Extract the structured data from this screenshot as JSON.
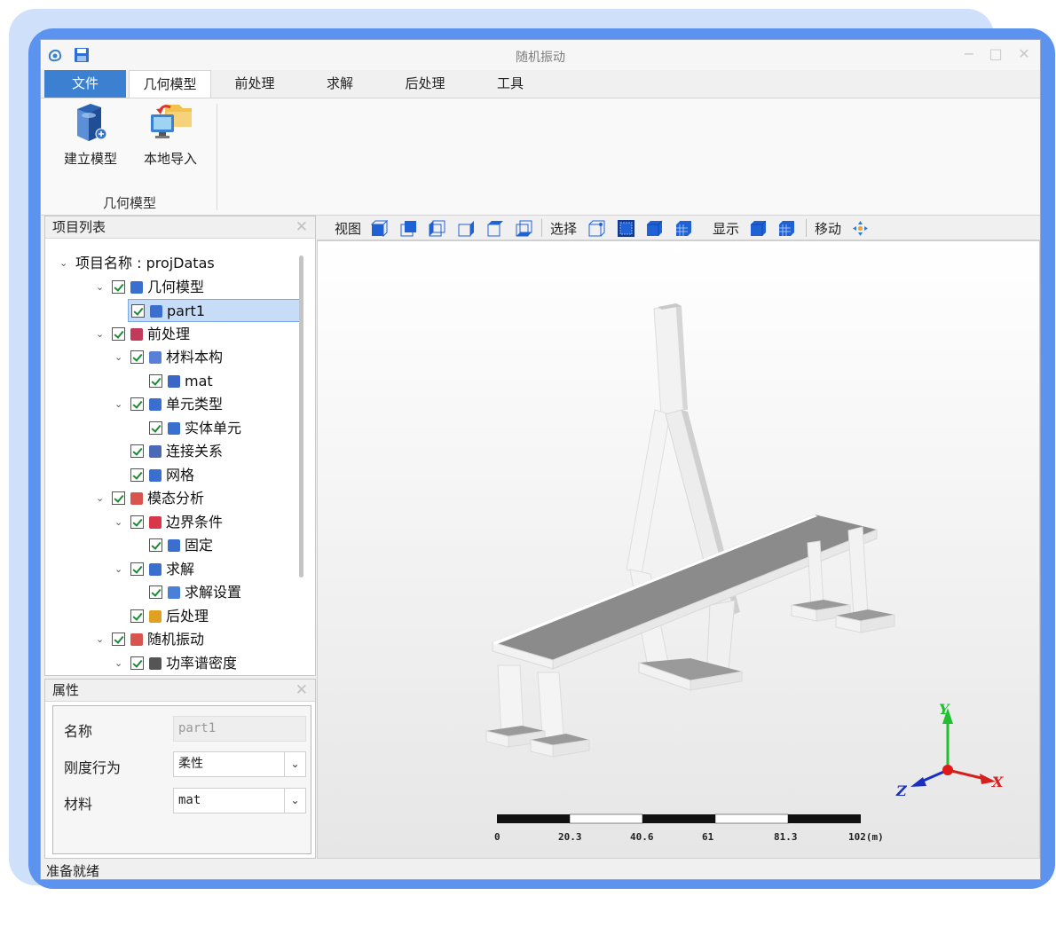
{
  "window": {
    "title": "随机振动",
    "minimize": "−",
    "maximize": "□",
    "close": "✕"
  },
  "menu": {
    "file": "文件",
    "tabs": [
      "几何模型",
      "前处理",
      "求解",
      "后处理",
      "工具"
    ]
  },
  "ribbon": {
    "buttons": [
      {
        "label": "建立模型",
        "icon": "build-model-icon"
      },
      {
        "label": "本地导入",
        "icon": "import-local-icon"
      }
    ],
    "group_label": "几何模型"
  },
  "project_panel": {
    "title": "项目列表",
    "close": "✕",
    "tree": [
      {
        "label": "项目名称 : projDatas",
        "level": 0,
        "expand": true,
        "checkbox": false
      },
      {
        "label": "几何模型",
        "level": 1,
        "expand": true,
        "checkbox": true,
        "icon": "geometry-icon"
      },
      {
        "label": "part1",
        "level": 2,
        "expand": false,
        "checkbox": true,
        "icon": "part-icon",
        "selected": true
      },
      {
        "label": "前处理",
        "level": 1,
        "expand": true,
        "checkbox": true,
        "icon": "preprocess-icon"
      },
      {
        "label": "材料本构",
        "level": 2,
        "expand": true,
        "checkbox": true,
        "icon": "material-icon"
      },
      {
        "label": "mat",
        "level": 3,
        "expand": false,
        "checkbox": true,
        "icon": "grid-icon"
      },
      {
        "label": "单元类型",
        "level": 2,
        "expand": true,
        "checkbox": true,
        "icon": "element-type-icon"
      },
      {
        "label": "实体单元",
        "level": 3,
        "expand": false,
        "checkbox": true,
        "icon": "solid-element-icon"
      },
      {
        "label": "连接关系",
        "level": 2,
        "expand": false,
        "checkbox": true,
        "icon": "connection-icon"
      },
      {
        "label": "网格",
        "level": 2,
        "expand": false,
        "checkbox": true,
        "icon": "mesh-icon"
      },
      {
        "label": "模态分析",
        "level": 1,
        "expand": true,
        "checkbox": true,
        "icon": "modal-analysis-icon"
      },
      {
        "label": "边界条件",
        "level": 2,
        "expand": true,
        "checkbox": true,
        "icon": "boundary-icon"
      },
      {
        "label": "固定",
        "level": 3,
        "expand": false,
        "checkbox": true,
        "icon": "fixed-icon"
      },
      {
        "label": "求解",
        "level": 2,
        "expand": true,
        "checkbox": true,
        "icon": "solve-icon"
      },
      {
        "label": "求解设置",
        "level": 3,
        "expand": false,
        "checkbox": true,
        "icon": "solve-settings-icon"
      },
      {
        "label": "后处理",
        "level": 2,
        "expand": false,
        "checkbox": true,
        "icon": "postprocess-icon"
      },
      {
        "label": "随机振动",
        "level": 1,
        "expand": true,
        "checkbox": true,
        "icon": "random-vibration-icon"
      },
      {
        "label": "功率谱密度",
        "level": 2,
        "expand": true,
        "checkbox": true,
        "icon": "psd-icon"
      }
    ]
  },
  "properties_panel": {
    "title": "属性",
    "close": "✕",
    "fields": [
      {
        "label": "名称",
        "value": "part1",
        "disabled": true
      },
      {
        "label": "刚度行为",
        "value": "柔性",
        "dropdown": true
      },
      {
        "label": "材料",
        "value": "mat",
        "dropdown": true
      }
    ]
  },
  "viewbar": {
    "view_label": "视图",
    "select_label": "选择",
    "display_label": "显示",
    "move_label": "移动"
  },
  "viewport": {
    "scale_labels": [
      "0",
      "20.3",
      "40.6",
      "61",
      "81.3",
      "102(m)"
    ],
    "axes": {
      "x": "X",
      "y": "Y",
      "z": "Z"
    }
  },
  "status": "准备就绪",
  "colors": {
    "accent": "#3b80d1",
    "frame": "#5b93ef",
    "frame_back": "#cfe0fb",
    "selection": "#c6dcf7"
  }
}
